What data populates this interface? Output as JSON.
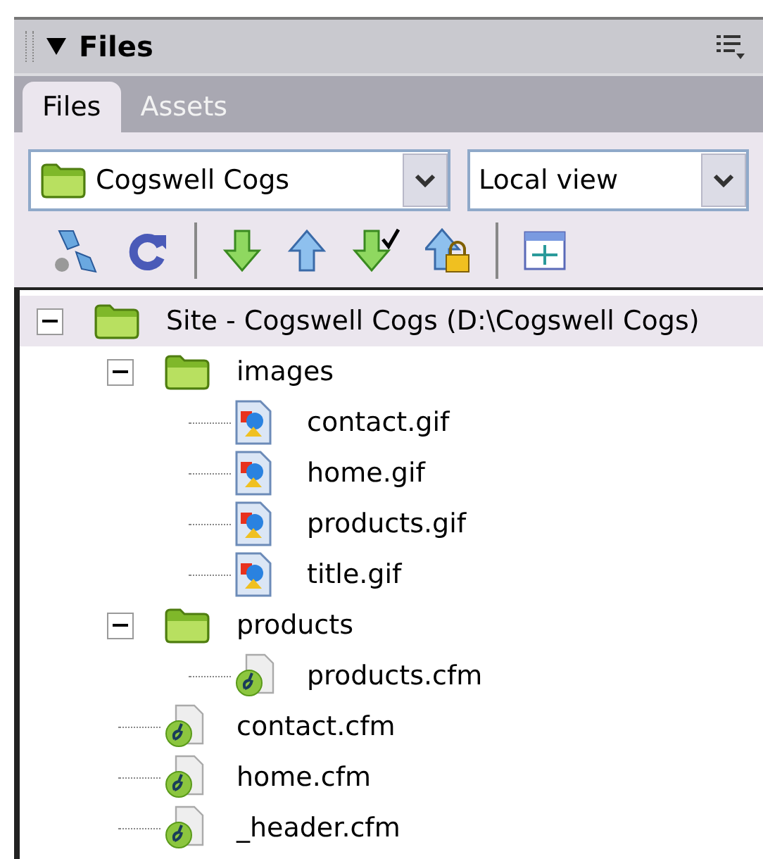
{
  "panel": {
    "title": "Files"
  },
  "tabs": [
    {
      "label": "Files",
      "selected": true
    },
    {
      "label": "Assets",
      "selected": false
    }
  ],
  "site_select": {
    "value": "Cogswell Cogs"
  },
  "view_select": {
    "value": "Local view"
  },
  "tree": [
    {
      "label": "Site - Cogswell Cogs (D:\\Cogswell Cogs)",
      "kind": "site",
      "expanded": true,
      "selected": true,
      "children": [
        {
          "label": "images",
          "kind": "folder",
          "expanded": true,
          "selected": false,
          "children": [
            {
              "label": "contact.gif",
              "kind": "image",
              "selected": false
            },
            {
              "label": "home.gif",
              "kind": "image",
              "selected": false
            },
            {
              "label": "products.gif",
              "kind": "image",
              "selected": false
            },
            {
              "label": "title.gif",
              "kind": "image",
              "selected": false
            }
          ]
        },
        {
          "label": "products",
          "kind": "folder",
          "expanded": true,
          "selected": false,
          "children": [
            {
              "label": "products.cfm",
              "kind": "cfm",
              "selected": false
            }
          ]
        },
        {
          "label": "contact.cfm",
          "kind": "cfm",
          "selected": false
        },
        {
          "label": "home.cfm",
          "kind": "cfm",
          "selected": false
        },
        {
          "label": "_header.cfm",
          "kind": "cfm",
          "selected": false
        }
      ]
    }
  ]
}
